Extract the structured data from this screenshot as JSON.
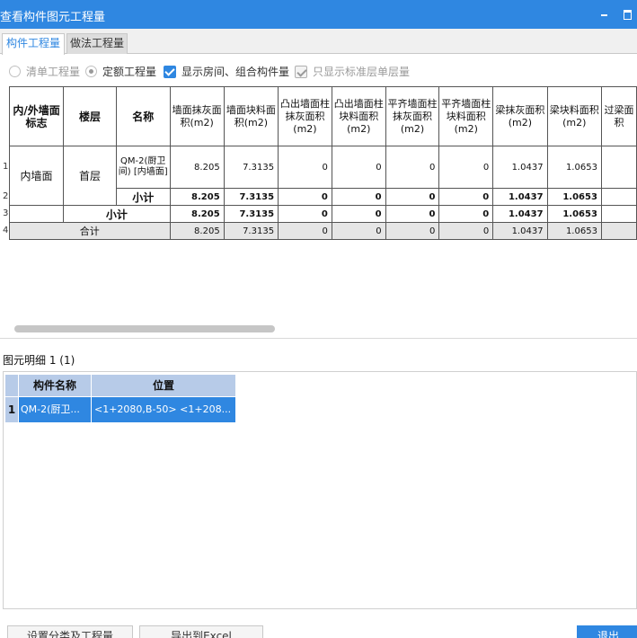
{
  "window": {
    "title": "查看构件图元工程量"
  },
  "tabs": [
    {
      "label": "构件工程量"
    },
    {
      "label": "做法工程量"
    }
  ],
  "options": {
    "radio_list_qty": "清单工程量",
    "radio_quota_qty": "定额工程量",
    "cb_show_rooms": "显示房间、组合构件量",
    "cb_std_floor_only": "只显示标准层单层量"
  },
  "table": {
    "headers": {
      "wall_flag": "内/外墙面标志",
      "floor": "楼层",
      "name": "名称",
      "cols": [
        "墙面抹灰面积(m2)",
        "墙面块料面积(m2)",
        "凸出墙面柱抹灰面积(m2)",
        "凸出墙面柱块料面积(m2)",
        "平齐墙面柱抹灰面积(m2)",
        "平齐墙面柱块料面积(m2)",
        "梁抹灰面积(m2)",
        "梁块料面积(m2)",
        "过梁面积"
      ]
    },
    "row_numbers": [
      "1",
      "2",
      "3",
      "4"
    ],
    "wall_flag_value": "内墙面",
    "floor_value": "首层",
    "name_value": "QM-2(厨卫间) [内墙面]",
    "subtotal_label": "小计",
    "total_label": "合计",
    "rows": {
      "r1": [
        "8.205",
        "7.3135",
        "0",
        "0",
        "0",
        "0",
        "1.0437",
        "1.0653",
        ""
      ],
      "r2": [
        "8.205",
        "7.3135",
        "0",
        "0",
        "0",
        "0",
        "1.0437",
        "1.0653",
        ""
      ],
      "r3": [
        "8.205",
        "7.3135",
        "0",
        "0",
        "0",
        "0",
        "1.0437",
        "1.0653",
        ""
      ],
      "r4": [
        "8.205",
        "7.3135",
        "0",
        "0",
        "0",
        "0",
        "1.0437",
        "1.0653",
        ""
      ]
    }
  },
  "detail": {
    "label": "图元明细 1 (1)",
    "headers": {
      "col1": "构件名称",
      "col2": "位置"
    },
    "rows": [
      {
        "rownum": "1",
        "name": "QM-2(厨卫...",
        "position": "<1+2080,B-50> <1+208..."
      }
    ]
  },
  "buttons": {
    "set_qty": "设置分类及工程量",
    "export_excel": "导出到Excel",
    "exit": "退出"
  }
}
